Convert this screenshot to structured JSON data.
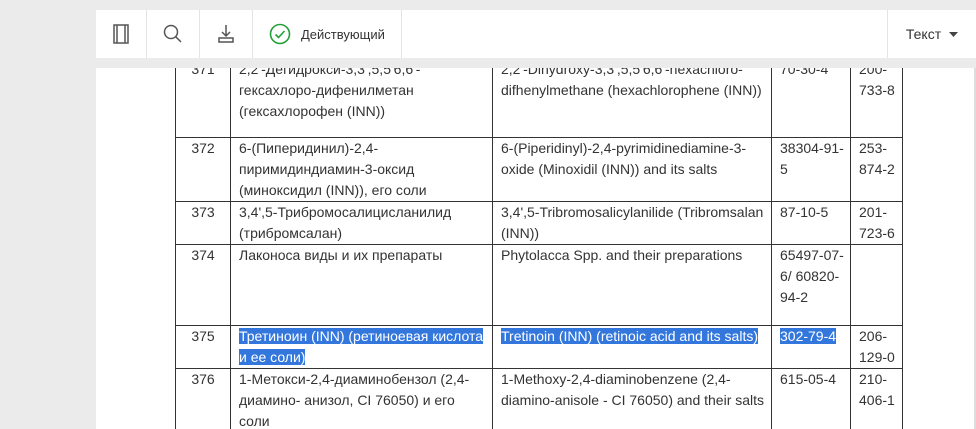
{
  "toolbar": {
    "status_label": "Действующий",
    "view_select": "Текст",
    "icons": [
      "document-icon",
      "search-icon",
      "download-icon",
      "check-circle-icon",
      "caret-down-icon"
    ],
    "status_color": "#21a038"
  },
  "table": {
    "rows": [
      {
        "num": "371",
        "ru": "2,2'-Дегидрокси-3,3',5,5'6,6'-гексахлоро-дифенилметан (гексахлорофен (INN))",
        "en": "2,2'-Dihydroxy-3,3',5,5'6,6'-hexachloro-difhenylmethane (hexachlorophene (INN))",
        "cas": "70-30-4",
        "ec": "200-733-8",
        "selected": false
      },
      {
        "num": "372",
        "ru": "6-(Пиперидинил)-2,4-пиримидиндиамин-3-оксид (миноксидил (INN)), его соли",
        "en": "6-(Piperidinyl)-2,4-pyrimidinediamine-3-oxide (Minoxidil (INN)) and its salts",
        "cas": "38304-91-5",
        "ec": "253-874-2",
        "selected": false
      },
      {
        "num": "373",
        "ru": "3,4',5-Трибромосалицисланилид (трибромсалан)",
        "en": "3,4',5-Tribromosalicylanilide (Tribromsalan (INN))",
        "cas": "87-10-5",
        "ec": "201-723-6",
        "selected": false
      },
      {
        "num": "374",
        "ru": "Лаконоса виды и их препараты",
        "en": "Phytolacca Spp. and their preparations",
        "cas": "65497-07-6/ 60820-94-2",
        "ec": "",
        "selected": false
      },
      {
        "num": "375",
        "ru": "Третиноин (INN) (ретиноевая кислота и ее соли)",
        "en": "Tretinoin (INN) (retinoic acid and its salts)",
        "cas": "302-79-4",
        "ec": "206-129-0",
        "selected": true
      },
      {
        "num": "376",
        "ru": "1-Метокси-2,4-диаминобензол (2,4-диамино- анизол, CI 76050) и его соли",
        "en": "1-Methoxy-2,4-diaminobenzene (2,4-diamino-anisole - CI 76050) and their salts",
        "cas": "615-05-4",
        "ec": "210-406-1",
        "selected": false
      }
    ]
  }
}
